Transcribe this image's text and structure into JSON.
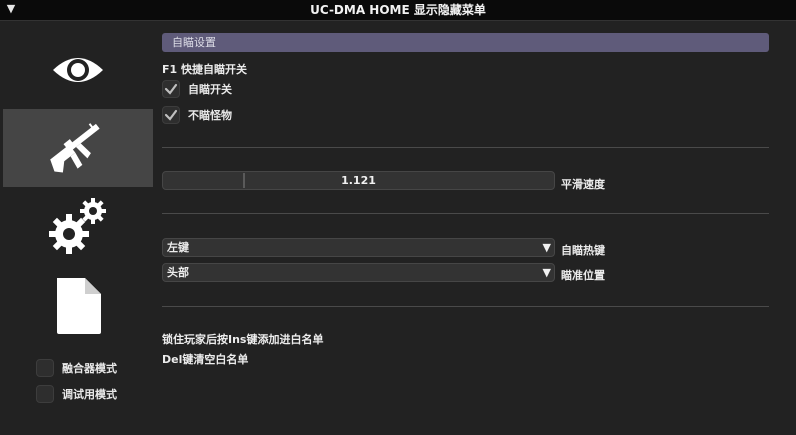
{
  "window": {
    "title": "UC-DMA HOME 显示隐藏菜单",
    "collapse_glyph": "▼"
  },
  "sidebar": {
    "nav": [
      {
        "name": "visuals",
        "icon": "eye-icon",
        "active": false
      },
      {
        "name": "aimbot",
        "icon": "rifle-icon",
        "active": true
      },
      {
        "name": "settings",
        "icon": "gears-icon",
        "active": false
      },
      {
        "name": "config",
        "icon": "document-icon",
        "active": false
      }
    ],
    "checkboxes": [
      {
        "label": "融合器模式",
        "checked": false
      },
      {
        "label": "调试用模式",
        "checked": false
      }
    ]
  },
  "main": {
    "section_title": "自瞄设置",
    "hotkey_hint": "F1 快捷自瞄开关",
    "checkboxes": [
      {
        "label": "自瞄开关",
        "checked": true
      },
      {
        "label": "不瞄怪物",
        "checked": true
      }
    ],
    "slider": {
      "label": "平滑速度",
      "value": "1.121"
    },
    "combos": [
      {
        "value": "左键",
        "label": "自瞄热键"
      },
      {
        "value": "头部",
        "label": "瞄准位置"
      }
    ],
    "notes": [
      "锁住玩家后按Ins键添加进白名单",
      "Del键清空白名单"
    ]
  },
  "colors": {
    "header": "#5f5b7a",
    "active_tab": "#454545",
    "background": "#222222",
    "titlebar": "#0a0a0a"
  }
}
